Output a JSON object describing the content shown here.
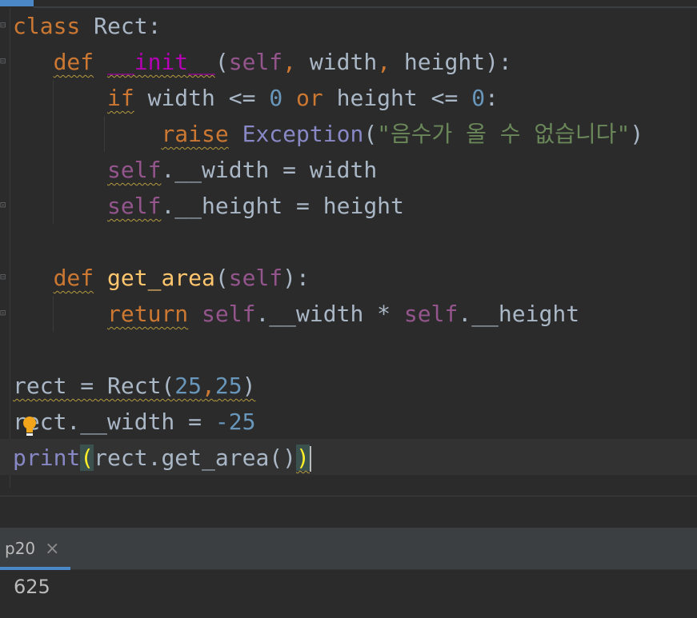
{
  "editor": {
    "lines": [
      [
        {
          "t": "class ",
          "c": "kw"
        },
        {
          "t": "Rect:",
          "c": "plain"
        }
      ],
      [
        {
          "t": "   "
        },
        {
          "t": "def",
          "c": "kw warn"
        },
        {
          "t": " "
        },
        {
          "t": "__init__",
          "c": "magic warn"
        },
        {
          "t": "(",
          "c": "plain"
        },
        {
          "t": "self",
          "c": "selfc"
        },
        {
          "t": ", ",
          "c": "kw"
        },
        {
          "t": "width",
          "c": "plain"
        },
        {
          "t": ", ",
          "c": "kw"
        },
        {
          "t": "height",
          "c": "plain"
        },
        {
          "t": "):",
          "c": "plain"
        }
      ],
      [
        {
          "t": "       "
        },
        {
          "t": "if",
          "c": "kw warn"
        },
        {
          "t": " width <= ",
          "c": "plain"
        },
        {
          "t": "0",
          "c": "num"
        },
        {
          "t": " or ",
          "c": "kw"
        },
        {
          "t": "height <= ",
          "c": "plain"
        },
        {
          "t": "0",
          "c": "num"
        },
        {
          "t": ":",
          "c": "plain"
        }
      ],
      [
        {
          "t": "           "
        },
        {
          "t": "raise",
          "c": "kw warn"
        },
        {
          "t": " "
        },
        {
          "t": "Exception",
          "c": "builtin"
        },
        {
          "t": "(",
          "c": "plain"
        },
        {
          "t": "\"음수가 올 수 없습니다\"",
          "c": "str"
        },
        {
          "t": ")",
          "c": "plain"
        }
      ],
      [
        {
          "t": "       "
        },
        {
          "t": "self",
          "c": "selfc warn"
        },
        {
          "t": ".__width = width",
          "c": "plain"
        }
      ],
      [
        {
          "t": "       "
        },
        {
          "t": "self",
          "c": "selfc warn"
        },
        {
          "t": ".__height = height",
          "c": "plain"
        }
      ],
      [],
      [
        {
          "t": "   "
        },
        {
          "t": "def",
          "c": "kw warn"
        },
        {
          "t": " "
        },
        {
          "t": "get_area",
          "c": "fn"
        },
        {
          "t": "(",
          "c": "plain"
        },
        {
          "t": "self",
          "c": "selfc"
        },
        {
          "t": "):",
          "c": "plain"
        }
      ],
      [
        {
          "t": "       "
        },
        {
          "t": "return",
          "c": "kw warn"
        },
        {
          "t": " "
        },
        {
          "t": "self",
          "c": "selfc"
        },
        {
          "t": ".__width * ",
          "c": "plain"
        },
        {
          "t": "self",
          "c": "selfc"
        },
        {
          "t": ".__height",
          "c": "plain"
        }
      ],
      [],
      [
        {
          "t": "rect = Rect(",
          "c": "plain warn"
        },
        {
          "t": "25",
          "c": "num warn"
        },
        {
          "t": ",",
          "c": "kw warn"
        },
        {
          "t": "25",
          "c": "num warn"
        },
        {
          "t": ")",
          "c": "plain warn"
        }
      ],
      [
        {
          "t": "rect.__width = ",
          "c": "plain"
        },
        {
          "t": "-25",
          "c": "num"
        }
      ],
      [
        {
          "t": "print",
          "c": "builtin"
        },
        {
          "t": "(",
          "c": "paren-match"
        },
        {
          "t": "rect.get_area()",
          "c": "plain"
        },
        {
          "t": ")",
          "c": "paren-match warn"
        }
      ]
    ]
  },
  "run_panel": {
    "tab_label": "p20",
    "close_glyph": "×",
    "output": "625"
  },
  "colors": {
    "keyword": "#cc7832",
    "function": "#ffc66d",
    "self": "#94558d",
    "number": "#6897bb",
    "string": "#6a8759",
    "text": "#a9b7c6",
    "accent": "#4a88c7"
  },
  "icons": [
    "bulb-icon",
    "fold-marker-icon",
    "close-icon"
  ]
}
